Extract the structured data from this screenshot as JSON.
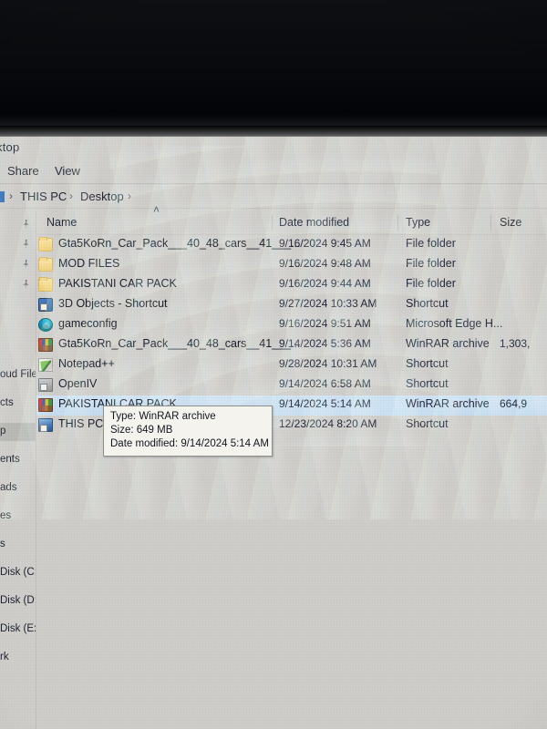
{
  "window": {
    "title_fragment": "ktop",
    "ribbon_tabs": [
      "Share",
      "View"
    ]
  },
  "breadcrumb": {
    "items": [
      "THIS PC",
      "Desktop"
    ],
    "separator": "›"
  },
  "columns": {
    "name": "Name",
    "date_modified": "Date modified",
    "type": "Type",
    "size": "Size",
    "sort_caret": "˄"
  },
  "files": [
    {
      "name": "Gta5KoRn_Car_Pack___40_48_cars__41___...",
      "date": "9/16/2024 9:45 AM",
      "type": "File folder",
      "size": "",
      "icon": "folder-icon",
      "selected": false
    },
    {
      "name": "MOD FILES",
      "date": "9/16/2024 9:48 AM",
      "type": "File folder",
      "size": "",
      "icon": "folder-icon",
      "selected": false
    },
    {
      "name": "PAKISTANI CAR PACK",
      "date": "9/16/2024 9:44 AM",
      "type": "File folder",
      "size": "",
      "icon": "folder-icon",
      "selected": false
    },
    {
      "name": "3D Objects - Shortcut",
      "date": "9/27/2024 10:33 AM",
      "type": "Shortcut",
      "size": "",
      "icon": "shortcut-icon",
      "selected": false
    },
    {
      "name": "gameconfig",
      "date": "9/16/2024 9:51 AM",
      "type": "Microsoft Edge H...",
      "size": "",
      "icon": "edge-icon",
      "selected": false
    },
    {
      "name": "Gta5KoRn_Car_Pack___40_48_cars__41___...",
      "date": "9/14/2024 5:36 AM",
      "type": "WinRAR archive",
      "size": "1,303,",
      "icon": "winrar-icon",
      "selected": false
    },
    {
      "name": "Notepad++",
      "date": "9/28/2024 10:31 AM",
      "type": "Shortcut",
      "size": "",
      "icon": "notepadpp-icon",
      "selected": false
    },
    {
      "name": "OpenIV",
      "date": "9/14/2024 6:58 AM",
      "type": "Shortcut",
      "size": "",
      "icon": "openiv-icon",
      "selected": false
    },
    {
      "name": "PAKISTANI CAR PACK",
      "date": "9/14/2024 5:14 AM",
      "type": "WinRAR archive",
      "size": "664,9",
      "icon": "winrar-icon",
      "selected": true
    },
    {
      "name": "THIS PC",
      "date": "12/23/2024 8:20 AM",
      "type": "Shortcut",
      "size": "",
      "icon": "thispc-icon",
      "selected": false
    }
  ],
  "tooltip": {
    "type_line": "Type: WinRAR archive",
    "size_line": "Size: 649 MB",
    "date_line": "Date modified: 9/14/2024 5:14 AM"
  },
  "nav_pane": {
    "items": [
      {
        "label": "",
        "pin": true,
        "selected": false
      },
      {
        "label": "",
        "pin": true,
        "selected": false
      },
      {
        "label": "",
        "pin": true,
        "selected": false
      },
      {
        "label": "",
        "pin": true,
        "selected": false
      },
      {
        "label": "oud Files",
        "pin": false,
        "selected": false
      },
      {
        "label": "cts",
        "pin": false,
        "selected": false
      },
      {
        "label": "p",
        "pin": false,
        "selected": true
      },
      {
        "label": "ents",
        "pin": false,
        "selected": false
      },
      {
        "label": "ads",
        "pin": false,
        "selected": false
      },
      {
        "label": "es",
        "pin": false,
        "selected": false
      },
      {
        "label": "s",
        "pin": false,
        "selected": false
      },
      {
        "label": "Disk (C:)",
        "pin": false,
        "selected": false
      },
      {
        "label": "Disk (D:)",
        "pin": false,
        "selected": false
      },
      {
        "label": "Disk (E:)",
        "pin": false,
        "selected": false
      },
      {
        "label": "rk",
        "pin": false,
        "selected": false
      }
    ]
  },
  "colors": {
    "selection": "#c6ddf0",
    "chrome": "#cfcecb",
    "text": "#151a27",
    "accent": "#2f6fbf"
  }
}
